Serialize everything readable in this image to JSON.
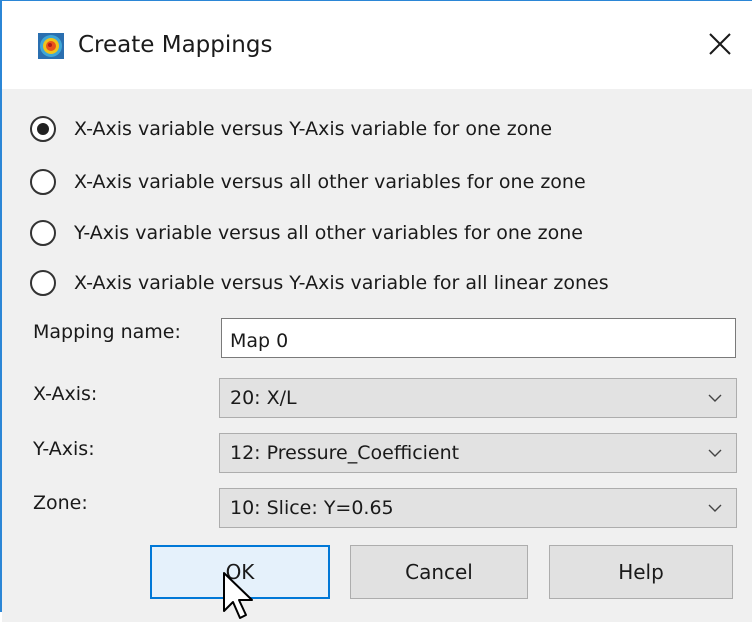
{
  "window": {
    "title": "Create Mappings",
    "icon": "tecplot-app-icon",
    "close_icon": "close-icon"
  },
  "options": [
    {
      "label": "X-Axis variable versus Y-Axis variable for one zone",
      "selected": true
    },
    {
      "label": "X-Axis variable versus all other variables for one zone",
      "selected": false
    },
    {
      "label": "Y-Axis variable versus all other variables for one zone",
      "selected": false
    },
    {
      "label": "X-Axis variable versus Y-Axis variable for all linear zones",
      "selected": false
    }
  ],
  "fields": {
    "mapping_name": {
      "label": "Mapping name:",
      "value": "Map 0"
    },
    "x_axis": {
      "label": "X-Axis:",
      "value": "20: X/L"
    },
    "y_axis": {
      "label": "Y-Axis:",
      "value": "12: Pressure_Coefficient"
    },
    "zone": {
      "label": "Zone:",
      "value": "10: Slice: Y=0.65"
    }
  },
  "buttons": {
    "ok": "OK",
    "cancel": "Cancel",
    "help": "Help"
  },
  "colors": {
    "accent": "#0078d7",
    "window_border": "#2b86d6",
    "dialog_bg": "#f0f0f0"
  }
}
